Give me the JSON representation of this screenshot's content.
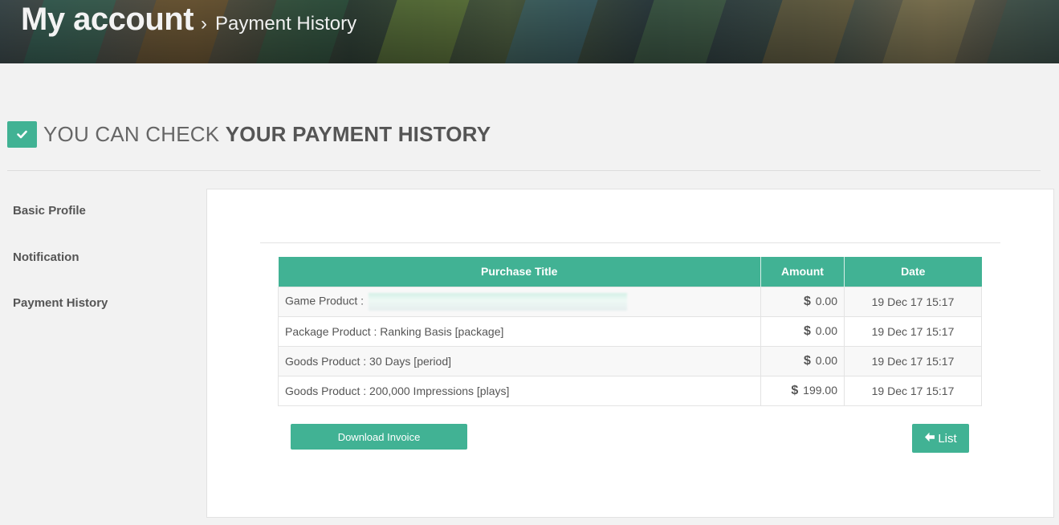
{
  "banner": {
    "title": "My account",
    "separator": "›",
    "subtitle": "Payment History"
  },
  "heading": {
    "prefix": "YOU CAN CHECK",
    "emphasis": "YOUR PAYMENT HISTORY",
    "icon": "check-icon"
  },
  "sidebar": {
    "items": [
      {
        "label": "Basic Profile"
      },
      {
        "label": "Notification"
      },
      {
        "label": "Payment History"
      }
    ]
  },
  "table": {
    "columns": [
      "Purchase Title",
      "Amount",
      "Date"
    ],
    "currency": "$",
    "rows": [
      {
        "title": "Game Product :",
        "amount": "0.00",
        "date": "19 Dec 17 15:17"
      },
      {
        "title": "Package Product : Ranking Basis [package]",
        "amount": "0.00",
        "date": "19 Dec 17 15:17"
      },
      {
        "title": "Goods Product : 30 Days [period]",
        "amount": "0.00",
        "date": "19 Dec 17 15:17"
      },
      {
        "title": "Goods Product : 200,000 Impressions [plays]",
        "amount": "199.00",
        "date": "19 Dec 17 15:17"
      }
    ]
  },
  "buttons": {
    "download_invoice": "Download Invoice",
    "list": "List",
    "list_icon": "arrow-left-icon"
  },
  "colors": {
    "accent": "#41b294",
    "background": "#f2f2f2"
  }
}
